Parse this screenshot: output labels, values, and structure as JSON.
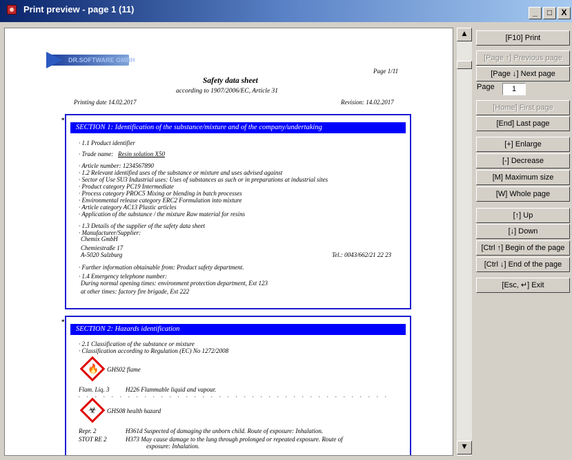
{
  "window": {
    "title": "Print preview - page 1 (11)",
    "min_label": "_",
    "max_label": "□",
    "close_label": "X"
  },
  "buttons": {
    "print": "[F10] Print",
    "prev": "[Page ↑] Previous page",
    "next": "[Page ↓] Next page",
    "page_label": "Page",
    "page_value": "1",
    "first": "[Home] First page",
    "last": "[End] Last page",
    "enlarge": "[+] Enlarge",
    "decrease": "[-] Decrease",
    "maximum": "[M] Maximum size",
    "whole": "[W] Whole page",
    "up": "[↑] Up",
    "down": "[↓] Down",
    "begin": "[Ctrl ↑] Begin of the page",
    "end": "[Ctrl ↓] End of the page",
    "exit": "[Esc, ↵] Exit"
  },
  "doc": {
    "logo": "DR.SOFTWARE GMBH",
    "page_no": "Page 1/11",
    "title": "Safety data sheet",
    "subtitle": "according to 1907/2006/EC, Article 31",
    "printing_date": "Printing date 14.02.2017",
    "revision": "Revision: 14.02.2017",
    "s1_title": "SECTION 1: Identification of the substance/mixture and of the company/undertaking",
    "s1_lines": [
      "· 1.1 Product identifier",
      "· Trade name:",
      "Resin solution X50",
      "· Article number: 1234567890",
      "· 1.2 Relevant identified uses of the substance or mixture and uses advised against",
      "· Sector of Use SU3 Industrial uses: Uses of substances as such or in preparations at industrial sites",
      "· Product category PC19 Intermediate",
      "· Process category PROC5 Mixing or blending in batch processes",
      "· Environmental release category ERC2 Formulation into mixture",
      "· Article category AC13 Plastic articles",
      "· Application of the substance / the mixture Raw material for resins",
      "· 1.3 Details of the supplier of the safety data sheet",
      "· Manufacturer/Supplier:",
      "Chemix GmbH",
      "Chemiestraße 17",
      "A-5020 Salzburg",
      "Tel.: 0043/662/21 22 23",
      "· Further information obtainable from: Product safety department.",
      "· 1.4 Emergency telephone number:",
      "During normal opening times: environment protection department, Ext 123",
      "at other times: factory fire brigade, Ext 222"
    ],
    "s2_title": "SECTION 2: Hazards identification",
    "s2_lines": [
      "· 2.1 Classification of the substance or mixture",
      "· Classification according to Regulation (EC) No 1272/2008",
      "GHS02 flame",
      "Flam. Liq. 3",
      "H226 Flammable liquid and vapour.",
      "GHS08 health hazard",
      "Repr. 2",
      "H361d Suspected of damaging the unborn child. Route of exposure: Inhalation.",
      "STOT RE 2",
      "H373 May cause damage to the lung through prolonged or repeated exposure. Route of",
      "exposure: Inhalation."
    ],
    "icons": {
      "flame": "flame-icon",
      "health": "health-hazard-icon"
    }
  },
  "colors": {
    "section_bar": "#0000ff",
    "section_border": "#1a1ad0",
    "hazard_border": "#e00000"
  }
}
